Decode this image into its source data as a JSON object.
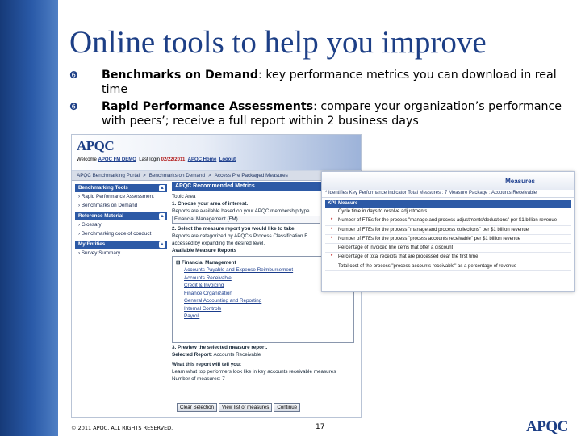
{
  "slide": {
    "title": "Online tools to help you improve",
    "bullets": [
      {
        "bold": "Benchmarks on Demand",
        "rest": ": key performance metrics you can download in real time"
      },
      {
        "bold": "Rapid Performance Assessments",
        "rest": ": compare your organization’s performance with peers’; receive a full report within 2 business days"
      }
    ],
    "footer": "© 2011 APQC. ALL RIGHTS RESERVED.",
    "page_number": "17",
    "footer_logo": "APQC"
  },
  "app": {
    "logo": "APQC",
    "welcome_label": "Welcome",
    "user": "APQC FM DEMO",
    "last_login_label": "Last login",
    "last_login_date": "02/22/2011",
    "home_link": "APQC Home",
    "logout_link": "Logout",
    "breadcrumbs": [
      "APQC Benchmarking Portal",
      "Benchmarks on Demand",
      "Access Pre Packaged Measures"
    ],
    "nav": [
      {
        "header": "Benchmarking Tools",
        "items": [
          "Rapid Performance Assessment",
          "Benchmarks on Demand"
        ]
      },
      {
        "header": "Reference Material",
        "items": [
          "Glossary",
          "Benchmarking code of conduct"
        ]
      },
      {
        "header": "My Entities",
        "items": [
          "Survey Summary"
        ]
      }
    ],
    "main": {
      "heading": "APQC Recommended Metrics",
      "topic_area": "Topic Area",
      "step1": "1. Choose your area of interest.",
      "reports_available": "Reports are available based on your APQC membership type",
      "select_value": "Financial Management (FM)",
      "step2": "2. Select the measure report you would like to take.",
      "categorized_1": "Reports are categorized by APQC's Process Classification F",
      "categorized_2": "accessed by expanding the desired level.",
      "available_label": "Available Measure Reports",
      "tree_root": "Financial Management",
      "tree_items": [
        "Accounts Payable and Expense Reimbursement",
        "Accounts Receivable",
        "Credit & Invoicing",
        "Finance Organization",
        "General Accounting and Reporting",
        "Internal Controls",
        "Payroll"
      ],
      "step3": "3. Preview the selected measure report.",
      "selected_label": "Selected Report:",
      "selected_value": "Accounts Receivable",
      "tell_you": "What this report will tell you:",
      "tell_you_text": "Learn what top performers look like in key accounts receivable measures",
      "number_measures": "Number of measures: 7"
    },
    "buttons": [
      "Clear Selection",
      "View list of measures",
      "Continue"
    ]
  },
  "measures_panel": {
    "title": "Measures",
    "subtitle": "* Identifies Key Performance Indicator   Total Measures : 7     Measure Package : Accounts Receivable",
    "col_kpi": "KPI",
    "col_measure": "Measure",
    "rows": [
      {
        "kpi": "",
        "measure": "Cycle time in days to resolve adjustments"
      },
      {
        "kpi": "*",
        "measure": "Number of FTEs for the process \"manage and process adjustments/deductions\" per $1 billion revenue"
      },
      {
        "kpi": "*",
        "measure": "Number of FTEs for the process \"manage and process collections\" per $1 billion revenue"
      },
      {
        "kpi": "*",
        "measure": "Number of FTEs for the process \"process accounts receivable\" per $1 billion revenue"
      },
      {
        "kpi": "",
        "measure": "Percentage of invoiced line items that offer a discount"
      },
      {
        "kpi": "*",
        "measure": "Percentage of total receipts that are processed clear the first time"
      },
      {
        "kpi": "",
        "measure": "Total cost of the process \"process accounts receivable\" as a percentage of revenue"
      }
    ]
  }
}
